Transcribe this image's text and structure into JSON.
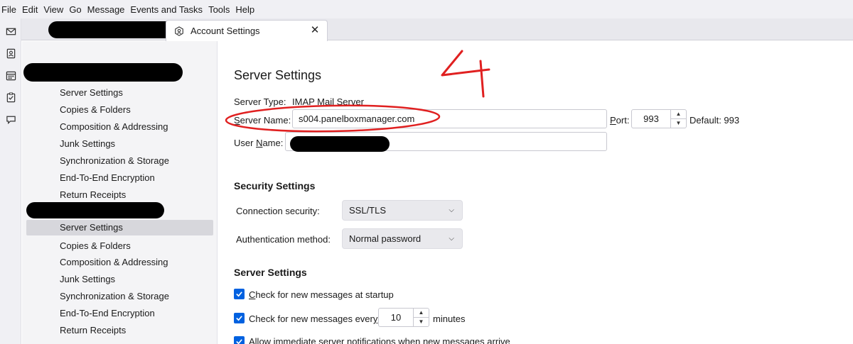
{
  "menubar": {
    "items": [
      "File",
      "Edit",
      "View",
      "Go",
      "Message",
      "Events and Tasks",
      "Tools",
      "Help"
    ]
  },
  "spaces": {
    "icons": [
      "mail-icon",
      "address-book-icon",
      "calendar-icon",
      "tasks-icon",
      "chat-icon"
    ]
  },
  "tabs": {
    "active_title": "Account Settings",
    "close_glyph": "✕"
  },
  "tree": {
    "account1_items": [
      "Server Settings",
      "Copies & Folders",
      "Composition & Addressing",
      "Junk Settings",
      "Synchronization & Storage",
      "End-To-End Encryption",
      "Return Receipts"
    ],
    "account2_items": [
      "Server Settings",
      "Copies & Folders",
      "Composition & Addressing",
      "Junk Settings",
      "Synchronization & Storage",
      "End-To-End Encryption",
      "Return Receipts"
    ],
    "selected": "Server Settings"
  },
  "server": {
    "heading": "Server Settings",
    "type_label": "Server Type:",
    "type_value": "IMAP Mail Server",
    "name_label": "Server Name:",
    "name_value": "s004.panelboxmanager.com",
    "port_label": "Port:",
    "port_value": "993",
    "default_label": "Default: 993",
    "user_label": "User Name:"
  },
  "security": {
    "heading": "Security Settings",
    "conn_label": "Connection security:",
    "conn_value": "SSL/TLS",
    "auth_label": "Authentication method:",
    "auth_value": "Normal password"
  },
  "settings2": {
    "heading": "Server Settings",
    "check_startup": "Check for new messages at startup",
    "check_every": "Check for new messages every",
    "every_value": "10",
    "minutes": "minutes",
    "allow_notify": "Allow immediate server notifications when new messages arrive"
  },
  "annotation": {
    "number": "4",
    "color": "#e02020"
  },
  "colors": {
    "accent": "#0061e0",
    "redaction": "#000000"
  }
}
